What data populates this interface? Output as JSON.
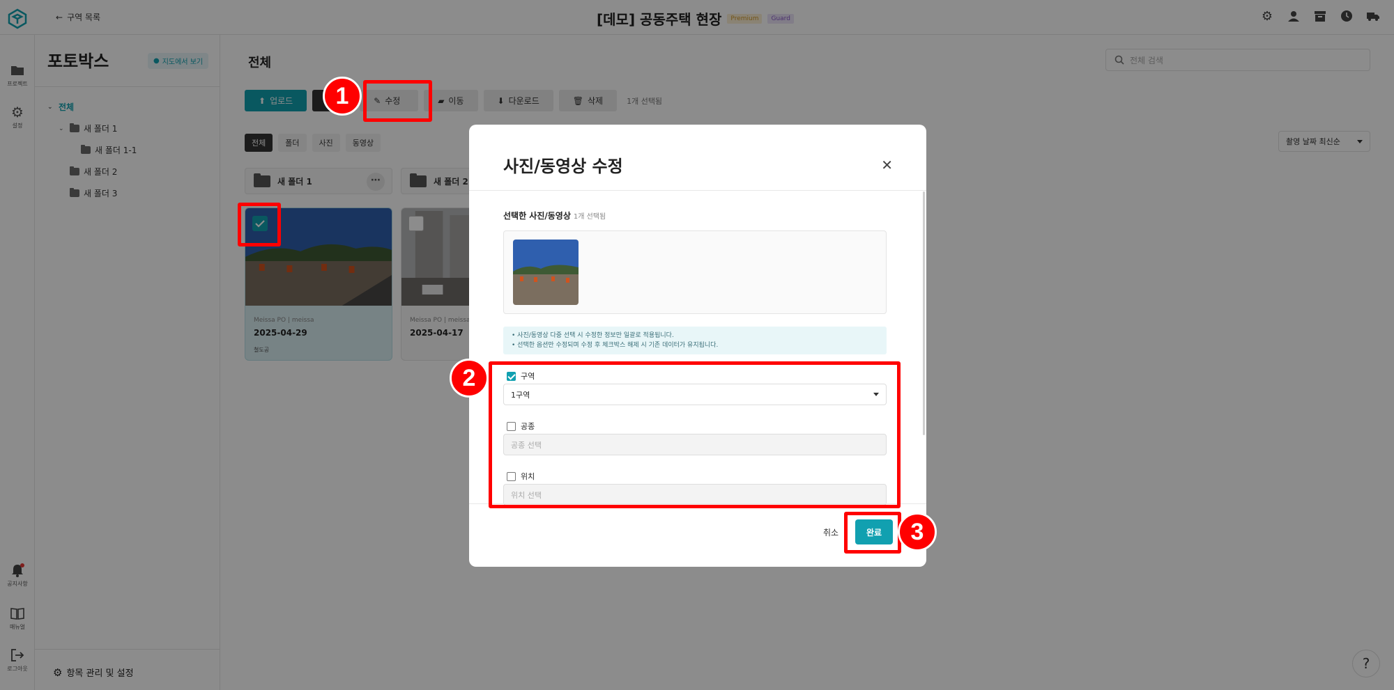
{
  "header": {
    "back_label": "구역 목록",
    "site_name": "[데모] 공동주택 현장",
    "badge_premium": "Premium",
    "badge_guard": "Guard",
    "icons": [
      "gear-icon",
      "user-icon",
      "archive-icon",
      "clock-icon",
      "truck-icon"
    ]
  },
  "rail": {
    "project": "프로젝트",
    "settings": "설정",
    "notice": "공지사항",
    "manual": "매뉴얼",
    "logout": "로그아웃"
  },
  "sidebar": {
    "title": "포토박스",
    "map_button": "지도에서 보기",
    "tree": [
      {
        "label": "전체",
        "level": 0,
        "expanded": true,
        "active": true
      },
      {
        "label": "새 폴더 1",
        "level": 1,
        "expanded": true
      },
      {
        "label": "새 폴더 1-1",
        "level": 2
      },
      {
        "label": "새 폴더 2",
        "level": 1
      },
      {
        "label": "새 폴더 3",
        "level": 1
      }
    ],
    "footer": "항목 관리 및 설정"
  },
  "main": {
    "title": "전체",
    "search_placeholder": "전체 검색",
    "toolbar": {
      "upload": "업로드",
      "edit": "수정",
      "move": "이동",
      "download": "다운로드",
      "delete": "삭제",
      "selected_count": "1개 선택됨"
    },
    "filters": [
      "전체",
      "폴더",
      "사진",
      "동영상"
    ],
    "sort": "촬영 날짜 최신순",
    "folders": [
      "새 폴더 1",
      "새 폴더 2"
    ],
    "photos": [
      {
        "author": "Meissa PO",
        "user": "meissa",
        "date": "2025-04-29",
        "tag": "철도공",
        "selected": true
      },
      {
        "author": "Meissa PO",
        "user": "meissa",
        "date": "2025-04-17",
        "tag": "",
        "selected": false
      }
    ]
  },
  "modal": {
    "title": "사진/동영상 수정",
    "selected_label": "선택한 사진/동영상",
    "selected_count": "1개 선택됨",
    "info_line1": "• 사진/동영상 다중 선택 시 수정한 정보만 일괄로 적용됩니다.",
    "info_line2": "• 선택한 옵션만 수정되며 수정 후 체크박스 해제 시 기존 데이터가 유지됩니다.",
    "fields": [
      {
        "label": "구역",
        "checked": true,
        "value": "1구역",
        "placeholder": ""
      },
      {
        "label": "공종",
        "checked": false,
        "value": "",
        "placeholder": "공종 선택"
      },
      {
        "label": "위치",
        "checked": false,
        "value": "",
        "placeholder": "위치 선택"
      }
    ],
    "cancel": "취소",
    "done": "완료"
  },
  "steps": [
    "1",
    "2",
    "3"
  ],
  "colors": {
    "accent": "#11a0b0",
    "highlight": "#ff0000"
  }
}
